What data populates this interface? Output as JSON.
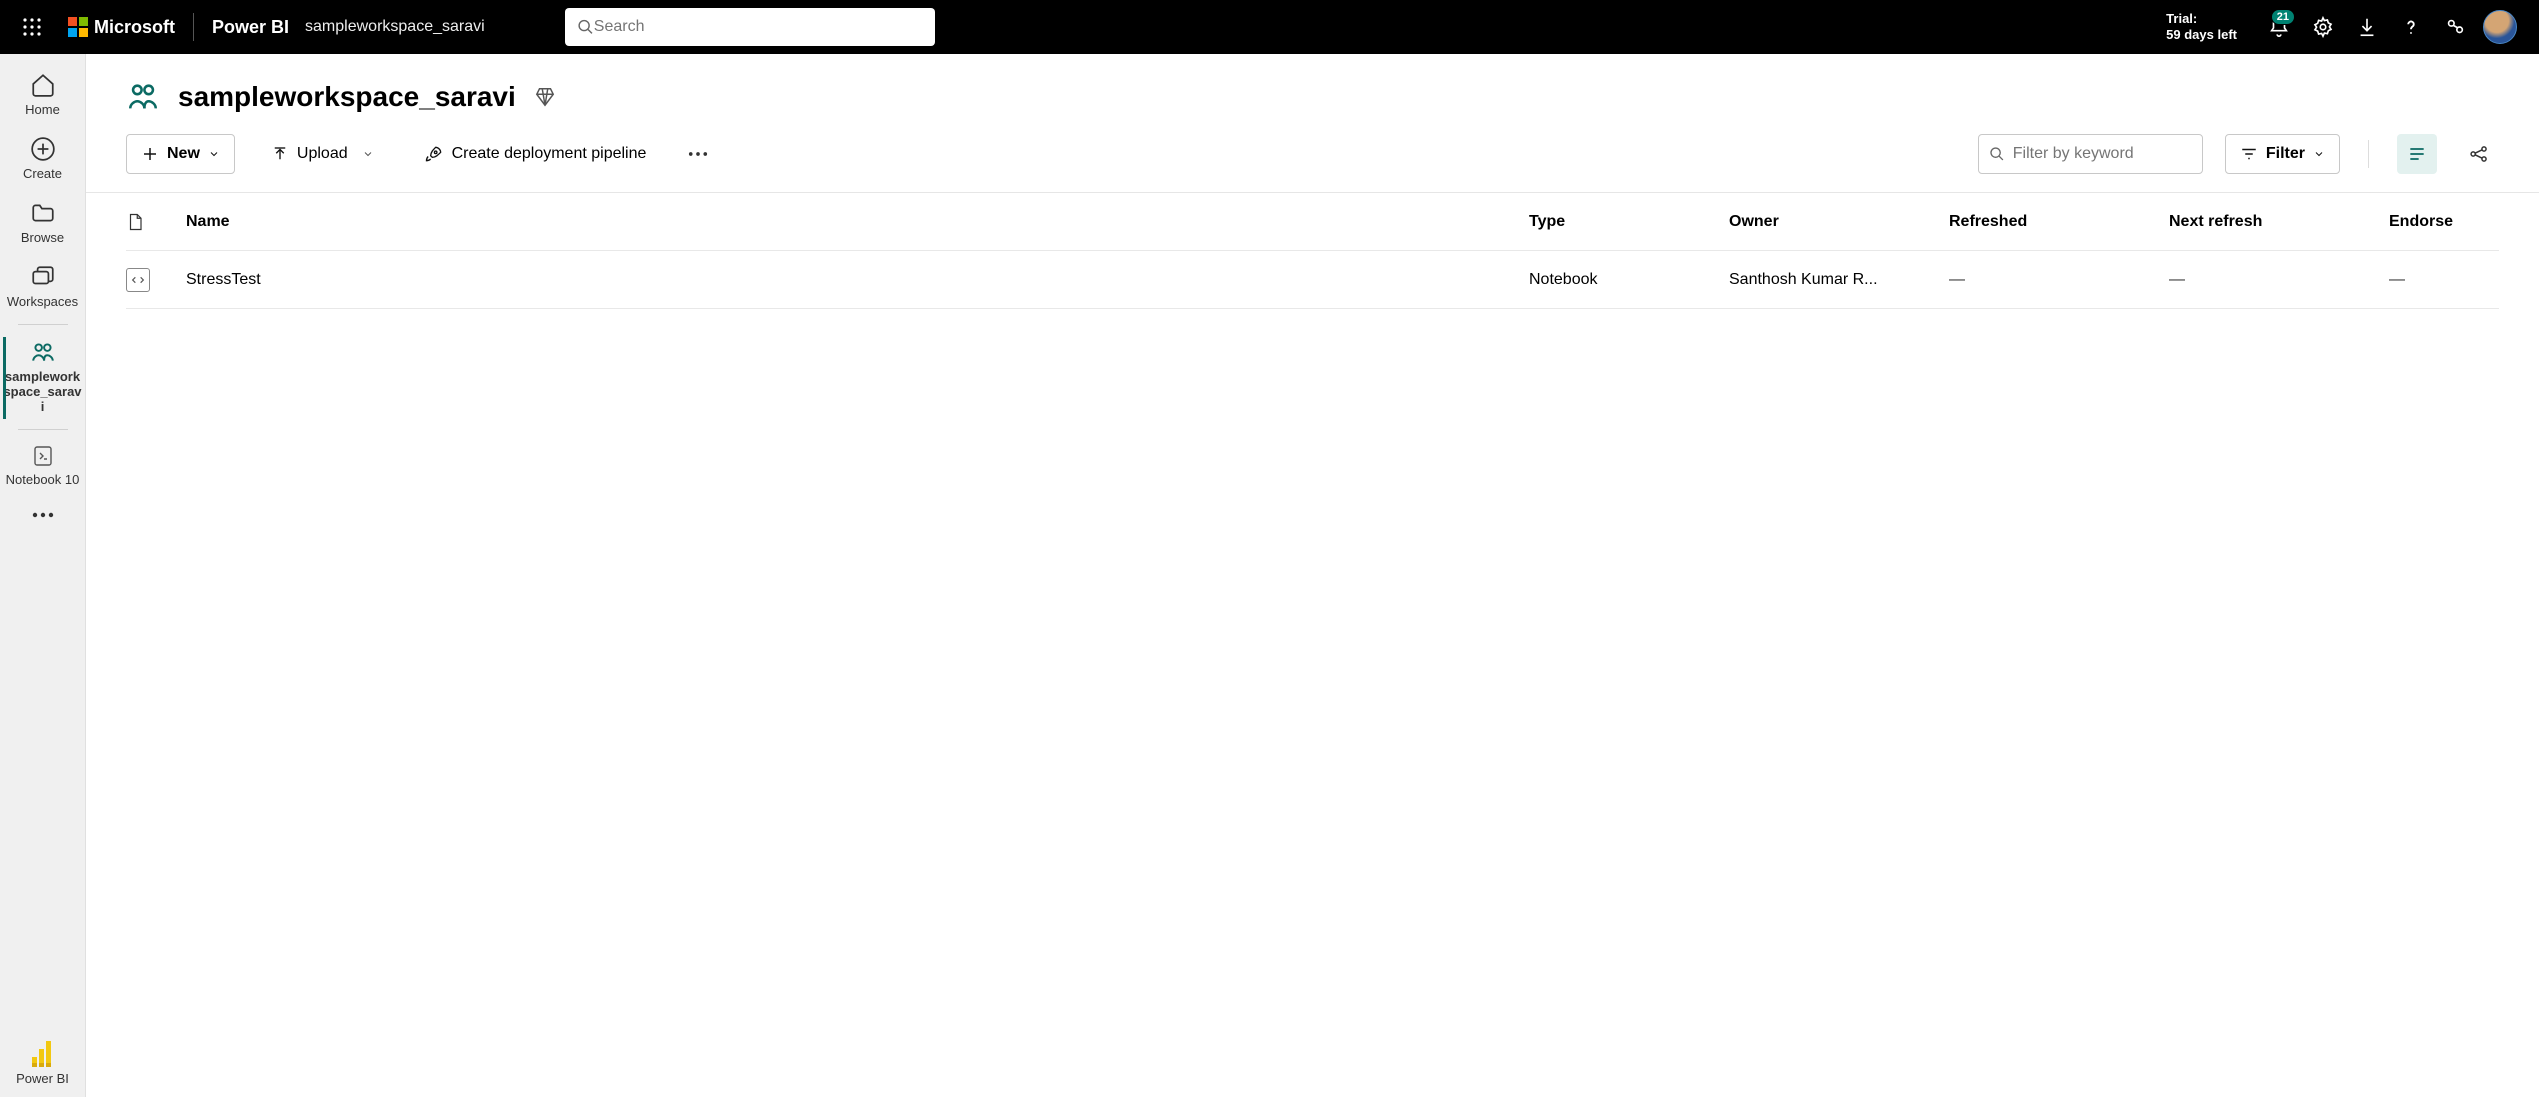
{
  "header": {
    "ms": "Microsoft",
    "product": "Power BI",
    "breadcrumb": "sampleworkspace_saravi",
    "search_placeholder": "Search",
    "trial_line1": "Trial:",
    "trial_line2": "59 days left",
    "notif_count": "21"
  },
  "rail": {
    "home": "Home",
    "create": "Create",
    "browse": "Browse",
    "workspaces": "Workspaces",
    "active_ws": "sampleworkspace_saravi",
    "notebook": "Notebook 10",
    "powerbi": "Power BI"
  },
  "workspace": {
    "title": "sampleworkspace_saravi"
  },
  "toolbar": {
    "new": "New",
    "upload": "Upload",
    "pipeline": "Create deployment pipeline",
    "filter_placeholder": "Filter by keyword",
    "filter": "Filter"
  },
  "columns": {
    "name": "Name",
    "type": "Type",
    "owner": "Owner",
    "refreshed": "Refreshed",
    "next": "Next refresh",
    "endorse": "Endorse"
  },
  "rows": [
    {
      "name": "StressTest",
      "type": "Notebook",
      "owner": "Santhosh Kumar R...",
      "refreshed": "—",
      "next": "—",
      "endorse": "—"
    }
  ]
}
